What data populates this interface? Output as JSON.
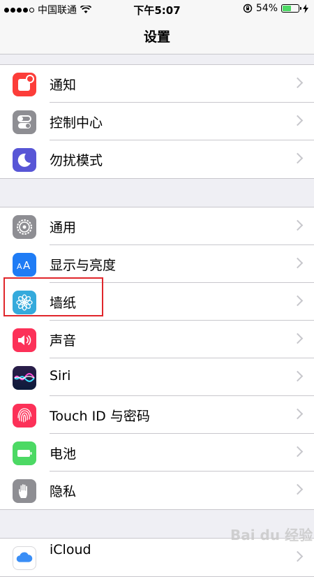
{
  "status_bar": {
    "carrier": "中国联通",
    "time": "下午5:07",
    "battery_percent": "54%",
    "battery_level": 0.54
  },
  "nav": {
    "title": "设置"
  },
  "groups": [
    {
      "items": [
        {
          "label": "通知",
          "icon": "notifications-icon",
          "color": "#fc3d39"
        },
        {
          "label": "控制中心",
          "icon": "control-center-icon",
          "color": "#8e8e93"
        },
        {
          "label": "勿扰模式",
          "icon": "moon-icon",
          "color": "#5856d6"
        }
      ]
    },
    {
      "items": [
        {
          "label": "通用",
          "icon": "gear-icon",
          "color": "#8e8e93"
        },
        {
          "label": "显示与亮度",
          "icon": "display-aa-icon",
          "color": "#1f7cf5"
        },
        {
          "label": "墙纸",
          "icon": "wallpaper-flower-icon",
          "color": "#35aadc"
        },
        {
          "label": "声音",
          "icon": "speaker-icon",
          "color": "#fc3158"
        },
        {
          "label": "Siri",
          "icon": "siri-icon",
          "color": "#1a1a2e"
        },
        {
          "label": "Touch ID 与密码",
          "icon": "fingerprint-icon",
          "color": "#fc3158"
        },
        {
          "label": "电池",
          "icon": "battery-icon",
          "color": "#4cd964"
        },
        {
          "label": "隐私",
          "icon": "hand-icon",
          "color": "#8e8e93"
        }
      ]
    },
    {
      "items": [
        {
          "label": "iCloud",
          "icon": "icloud-icon",
          "color": "#ffffff"
        }
      ]
    }
  ],
  "watermark": "Bai du 经验"
}
